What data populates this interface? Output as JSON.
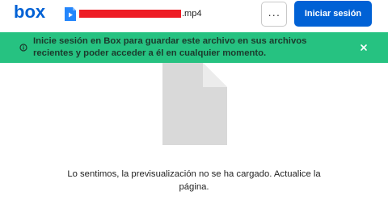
{
  "header": {
    "logo_text": "box",
    "file_extension": ".mp4",
    "more_label": "···",
    "login_label": "Iniciar sesión"
  },
  "banner": {
    "message": "Inicie sesión en Box para guardar este archivo en sus archivos recientes y poder acceder a él en cualquier momento."
  },
  "preview": {
    "error_message": "Lo sentimos, la previsualización no se ha cargado. Actualice la página."
  },
  "colors": {
    "brand_blue": "#0061d5",
    "banner_green": "#26c281",
    "redaction_red": "#ee1c25",
    "placeholder_gray": "#d9d9d9"
  },
  "icons": {
    "logo": "box-logo",
    "file_type": "video-file-icon",
    "banner": "info-circle-icon",
    "close": "close-icon",
    "preview": "document-placeholder-icon"
  }
}
